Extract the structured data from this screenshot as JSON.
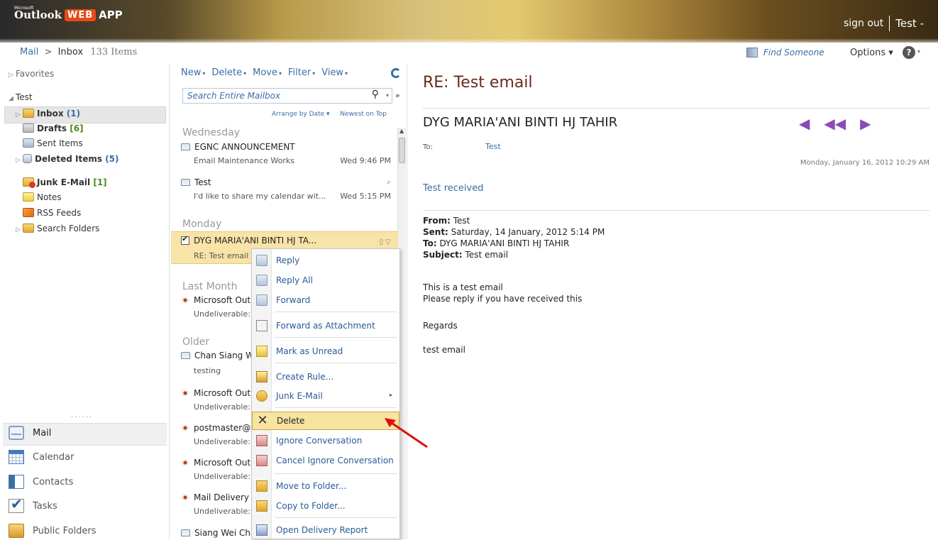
{
  "header": {
    "brand_ms": "Microsoft",
    "brand_outlook": "Outlook",
    "brand_web": "WEB",
    "brand_app": "APP",
    "sign_out": "sign out",
    "user": "Test -"
  },
  "crumbs": {
    "mail": "Mail",
    "arrow": ">",
    "inbox": "Inbox",
    "count": "133 Items",
    "find_someone": "Find Someone",
    "options": "Options ▾",
    "help": "?"
  },
  "nav": {
    "favorites": "Favorites",
    "test": "Test",
    "inbox": "Inbox",
    "inbox_count": "(1)",
    "drafts": "Drafts",
    "drafts_count": "[6]",
    "sent": "Sent Items",
    "deleted": "Deleted Items",
    "deleted_count": "(5)",
    "junk": "Junk E-Mail",
    "junk_count": "[1]",
    "notes": "Notes",
    "rss": "RSS Feeds",
    "search_folders": "Search Folders",
    "dots": "......"
  },
  "modules": {
    "mail": "Mail",
    "calendar": "Calendar",
    "contacts": "Contacts",
    "tasks": "Tasks",
    "public_folders": "Public Folders"
  },
  "list": {
    "toolbar": {
      "new": "New",
      "delete": "Delete",
      "move": "Move",
      "filter": "Filter",
      "view": "View"
    },
    "search_placeholder": "Search Entire Mailbox",
    "arrange_by": "Arrange by Date ▾",
    "newest": "Newest on Top",
    "groups": {
      "wednesday": "Wednesday",
      "monday": "Monday",
      "last_month": "Last Month",
      "older": "Older"
    },
    "items": [
      {
        "from": "EGNC ANNOUNCEMENT",
        "subject": "Email Maintenance Works",
        "date": "Wed 9:46 PM"
      },
      {
        "from": "Test",
        "subject": "I'd like to share my calendar wit...",
        "date": "Wed 5:15 PM"
      },
      {
        "from": "DYG MARIA'ANI BINTI HJ TA...",
        "subject": "RE: Test email",
        "date": ""
      },
      {
        "from": "Microsoft Outl",
        "subject": "Undeliverable: T",
        "date": ""
      },
      {
        "from": "Chan Siang We",
        "subject": "testing",
        "date": ""
      },
      {
        "from": "Microsoft Outl",
        "subject": "Undeliverable: t",
        "date": ""
      },
      {
        "from": "postmaster@n",
        "subject": "Undeliverable: t",
        "date": ""
      },
      {
        "from": "Microsoft Outl",
        "subject": "Undeliverable: t",
        "date": ""
      },
      {
        "from": "Mail Delivery S",
        "subject": "Undeliverable: t",
        "date": ""
      },
      {
        "from": "Siang Wei Cha",
        "subject": "",
        "date": ""
      }
    ]
  },
  "context_menu": {
    "reply": "Reply",
    "reply_all": "Reply All",
    "forward": "Forward",
    "forward_attachment": "Forward as Attachment",
    "mark_unread": "Mark as Unread",
    "create_rule": "Create Rule...",
    "junk": "Junk E-Mail",
    "delete": "Delete",
    "ignore": "Ignore Conversation",
    "cancel_ignore": "Cancel Ignore Conversation",
    "move": "Move to Folder...",
    "copy": "Copy to Folder...",
    "delivery_report": "Open Delivery Report"
  },
  "reading": {
    "title": "RE: Test email",
    "sender": "DYG MARIA'ANI BINTI HJ TAHIR",
    "to_label": "To:",
    "to": "Test",
    "date": "Monday, January 16, 2012 10:29 AM",
    "received": "Test received",
    "from_label": "From:",
    "from": "Test",
    "sent_label": "Sent:",
    "sent": "Saturday, 14 January, 2012 5:14 PM",
    "to2_label": "To:",
    "to2": "DYG MARIA'ANI BINTI HJ TAHIR",
    "subject_label": "Subject:",
    "subject": "Test email",
    "body1": "This is a test email",
    "body2": "Please reply if you have received this",
    "body3": "Regards",
    "body4": "test email"
  },
  "colors": {
    "accent": "#3a6ea5",
    "selection": "#f8e4a8",
    "title": "#6a2a1a"
  }
}
